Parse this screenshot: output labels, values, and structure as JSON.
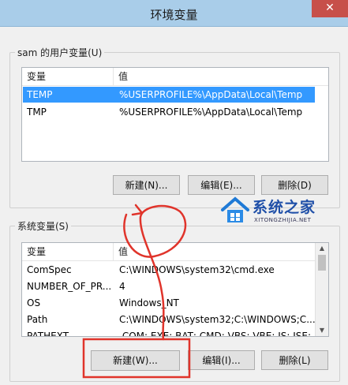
{
  "window": {
    "title": "环境变量",
    "close_glyph": "✕"
  },
  "user_vars": {
    "label": "sam 的用户变量(U)",
    "columns": [
      "变量",
      "值"
    ],
    "rows": [
      {
        "name": "TEMP",
        "value": "%USERPROFILE%\\AppData\\Local\\Temp",
        "selected": true
      },
      {
        "name": "TMP",
        "value": "%USERPROFILE%\\AppData\\Local\\Temp",
        "selected": false
      }
    ],
    "buttons": {
      "new": "新建(N)...",
      "edit": "编辑(E)...",
      "delete": "删除(D)"
    }
  },
  "system_vars": {
    "label": "系统变量(S)",
    "columns": [
      "变量",
      "值"
    ],
    "rows": [
      {
        "name": "ComSpec",
        "value": "C:\\WINDOWS\\system32\\cmd.exe"
      },
      {
        "name": "NUMBER_OF_PR...",
        "value": "4"
      },
      {
        "name": "OS",
        "value": "Windows_NT"
      },
      {
        "name": "Path",
        "value": "C:\\WINDOWS\\system32;C:\\WINDOWS;C..."
      },
      {
        "name": "PATHEXT",
        "value": ".COM;.EXE;.BAT;.CMD;.VBS;.VBE;.JS;.JSE;..."
      }
    ],
    "buttons": {
      "new": "新建(W)...",
      "edit": "编辑(I)...",
      "delete": "删除(L)"
    }
  },
  "watermark": {
    "title": "系统之家",
    "subtitle": "XITONGZHIJIA.NET"
  },
  "colors": {
    "selection": "#3399ff",
    "annotation": "#e0342b",
    "titlebar": "#a9cde9"
  }
}
